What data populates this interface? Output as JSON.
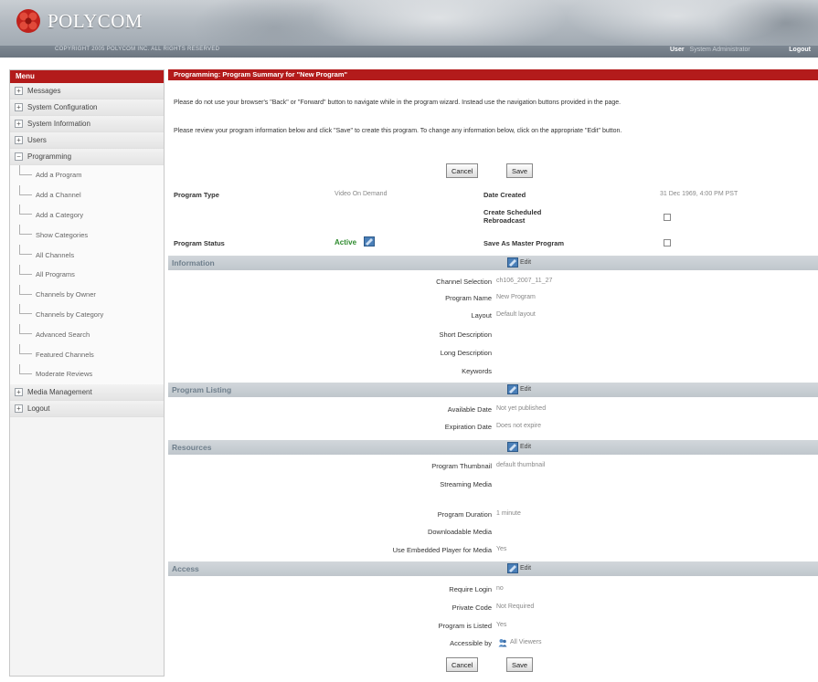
{
  "header": {
    "brand": "POLYCOM",
    "copyright": "COPYRIGHT 2005 POLYCOM INC. ALL RIGHTS RESERVED",
    "user_label": "User",
    "user_name": "System Administrator",
    "logout": "Logout"
  },
  "sidebar": {
    "title": "Menu",
    "items": [
      {
        "label": "Messages",
        "toggle": "+"
      },
      {
        "label": "System Configuration",
        "toggle": "+"
      },
      {
        "label": "System Information",
        "toggle": "+"
      },
      {
        "label": "Users",
        "toggle": "+"
      },
      {
        "label": "Programming",
        "toggle": "−"
      }
    ],
    "programming_children": [
      "Add a Program",
      "Add a Channel",
      "Add a Category",
      "Show Categories",
      "All Channels",
      "All Programs",
      "Channels by Owner",
      "Channels by Category",
      "Advanced Search",
      "Featured Channels",
      "Moderate Reviews"
    ],
    "bottom_items": [
      {
        "label": "Media Management",
        "toggle": "+"
      },
      {
        "label": "Logout",
        "toggle": "+"
      }
    ]
  },
  "main": {
    "title": "Programming: Program Summary for \"New Program\"",
    "note1": "Please do not use your browser's \"Back\" or \"Forward\" button to navigate while in the program wizard. Instead use the navigation buttons provided in the page.",
    "note2": "Please review your program information below and click \"Save\" to create this program. To change any information below, click on the appropriate \"Edit\" button.",
    "cancel": "Cancel",
    "save": "Save",
    "edit": "Edit",
    "summary": {
      "program_type_label": "Program Type",
      "program_type_value": "Video On Demand",
      "date_created_label": "Date Created",
      "date_created_value": "31 Dec 1969, 4:00 PM PST",
      "create_rebroadcast_label": "Create Scheduled Rebroadcast",
      "program_status_label": "Program Status",
      "program_status_value": "Active",
      "save_master_label": "Save As Master Program"
    },
    "information": {
      "title": "Information",
      "rows": [
        {
          "label": "Channel Selection",
          "value": "ch106_2007_11_27"
        },
        {
          "label": "Program Name",
          "value": "New Program"
        },
        {
          "label": "Layout",
          "value": "Default layout"
        },
        {
          "label": "Short Description",
          "value": ""
        },
        {
          "label": "Long Description",
          "value": ""
        },
        {
          "label": "Keywords",
          "value": ""
        }
      ]
    },
    "listing": {
      "title": "Program Listing",
      "rows": [
        {
          "label": "Available Date",
          "value": "Not yet published"
        },
        {
          "label": "Expiration Date",
          "value": "Does not expire"
        }
      ]
    },
    "resources": {
      "title": "Resources",
      "rows": [
        {
          "label": "Program Thumbnail",
          "value": "default thumbnail"
        },
        {
          "label": "Streaming Media",
          "value": ""
        },
        {
          "label": "Program Duration",
          "value": "1 minute"
        },
        {
          "label": "Downloadable Media",
          "value": ""
        },
        {
          "label": "Use Embedded Player for Media",
          "value": "Yes"
        }
      ]
    },
    "access": {
      "title": "Access",
      "rows": [
        {
          "label": "Require Login",
          "value": "no"
        },
        {
          "label": "Private Code",
          "value": "Not Required"
        },
        {
          "label": "Program is Listed",
          "value": "Yes"
        },
        {
          "label": "Accessible by",
          "value": "All Viewers"
        }
      ]
    }
  },
  "colors": {
    "brand_red": "#b31b1b",
    "section_bg": "#c8ced3",
    "active_green": "#2e8b2e"
  }
}
